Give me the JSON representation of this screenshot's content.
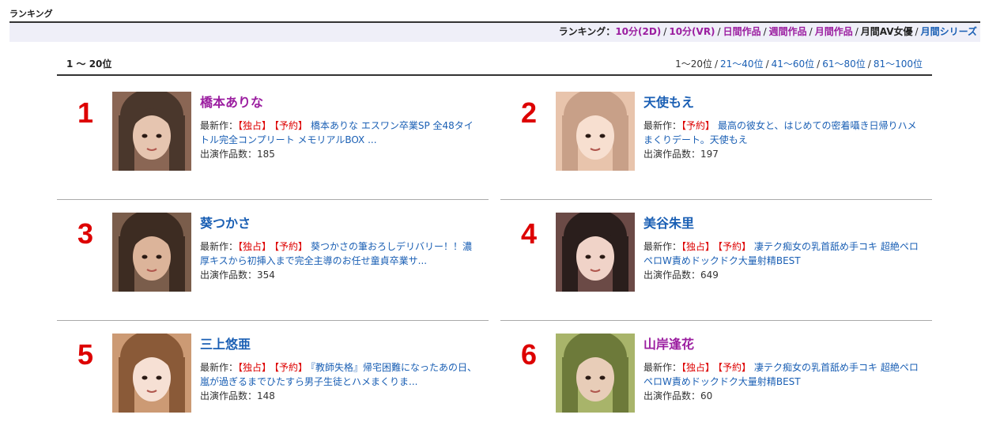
{
  "page": {
    "title": "ランキング"
  },
  "nav": {
    "lead": "ランキング：",
    "links": [
      {
        "label": "10分(2D)",
        "color": "#9b1ea0",
        "current": false
      },
      {
        "label": "10分(VR)",
        "color": "#9b1ea0",
        "current": false
      },
      {
        "label": "日間作品",
        "color": "#9b1ea0",
        "current": false
      },
      {
        "label": "週間作品",
        "color": "#9b1ea0",
        "current": false
      },
      {
        "label": "月間作品",
        "color": "#9b1ea0",
        "current": false
      },
      {
        "label": "月間AV女優",
        "color": "#222222",
        "current": true
      },
      {
        "label": "月間シリーズ",
        "color": "#1a5fb4",
        "current": false
      }
    ],
    "separator": "/"
  },
  "range": {
    "title": "1 〜 20位",
    "current": "1〜20位",
    "pages": [
      "21〜40位",
      "41〜60位",
      "61〜80位",
      "81〜100位"
    ],
    "separator": "/"
  },
  "labels": {
    "latest_work": "最新作：",
    "works_count": "出演作品数："
  },
  "colors": {
    "rank": "#dd0000",
    "name_purple": "#9b1ea0",
    "name_blue": "#1a5fb4",
    "tag_red": "#dd0000",
    "link_blue": "#1a5fb4"
  },
  "actresses": [
    {
      "rank": "1",
      "name": "橋本ありな",
      "name_color": "#9b1ea0",
      "tags": [
        "【独占】",
        "【予約】"
      ],
      "work": "橋本ありな エスワン卒業SP 全48タイトル完全コンプリート メモリアルBOX ...",
      "count": "185",
      "photo_colors": [
        "#4a372c",
        "#8a6654",
        "#e6c5b0"
      ]
    },
    {
      "rank": "2",
      "name": "天使もえ",
      "name_color": "#1a5fb4",
      "tags": [
        "【予約】"
      ],
      "work": "最高の彼女と、はじめての密着囁き日帰りハメまくりデート。天使もえ",
      "count": "197",
      "photo_colors": [
        "#c8a088",
        "#e8c4ac",
        "#f7dfd0"
      ]
    },
    {
      "rank": "3",
      "name": "葵つかさ",
      "name_color": "#1a5fb4",
      "tags": [
        "【独占】",
        "【予約】"
      ],
      "work": "葵つかさの筆おろしデリバリー！！濃厚キスから初挿入まで完全主導のお任せ童貞卒業サ...",
      "count": "354",
      "photo_colors": [
        "#3d2c22",
        "#7a5d4b",
        "#dcb49a"
      ]
    },
    {
      "rank": "4",
      "name": "美谷朱里",
      "name_color": "#1a5fb4",
      "tags": [
        "【独占】",
        "【予約】"
      ],
      "work": "凄テク痴女の乳首舐め手コキ 超絶ペロペロW責めドックドク大量射精BEST",
      "count": "649",
      "photo_colors": [
        "#2a1e1c",
        "#6b4a46",
        "#f0d3c8"
      ]
    },
    {
      "rank": "5",
      "name": "三上悠亜",
      "name_color": "#1a5fb4",
      "tags": [
        "【独占】",
        "【予約】"
      ],
      "work": "『教師失格』帰宅困難になったあの日、嵐が過ぎるまでひたすら男子生徒とハメまくりま...",
      "count": "148",
      "photo_colors": [
        "#8a5a38",
        "#cc9a74",
        "#f6e0d4"
      ]
    },
    {
      "rank": "6",
      "name": "山岸逢花",
      "name_color": "#9b1ea0",
      "tags": [
        "【独占】",
        "【予約】"
      ],
      "work": "凄テク痴女の乳首舐め手コキ 超絶ペロペロW責めドックドク大量射精BEST",
      "count": "60",
      "photo_colors": [
        "#6d7a3a",
        "#a8b46a",
        "#e8cdb8"
      ]
    }
  ]
}
